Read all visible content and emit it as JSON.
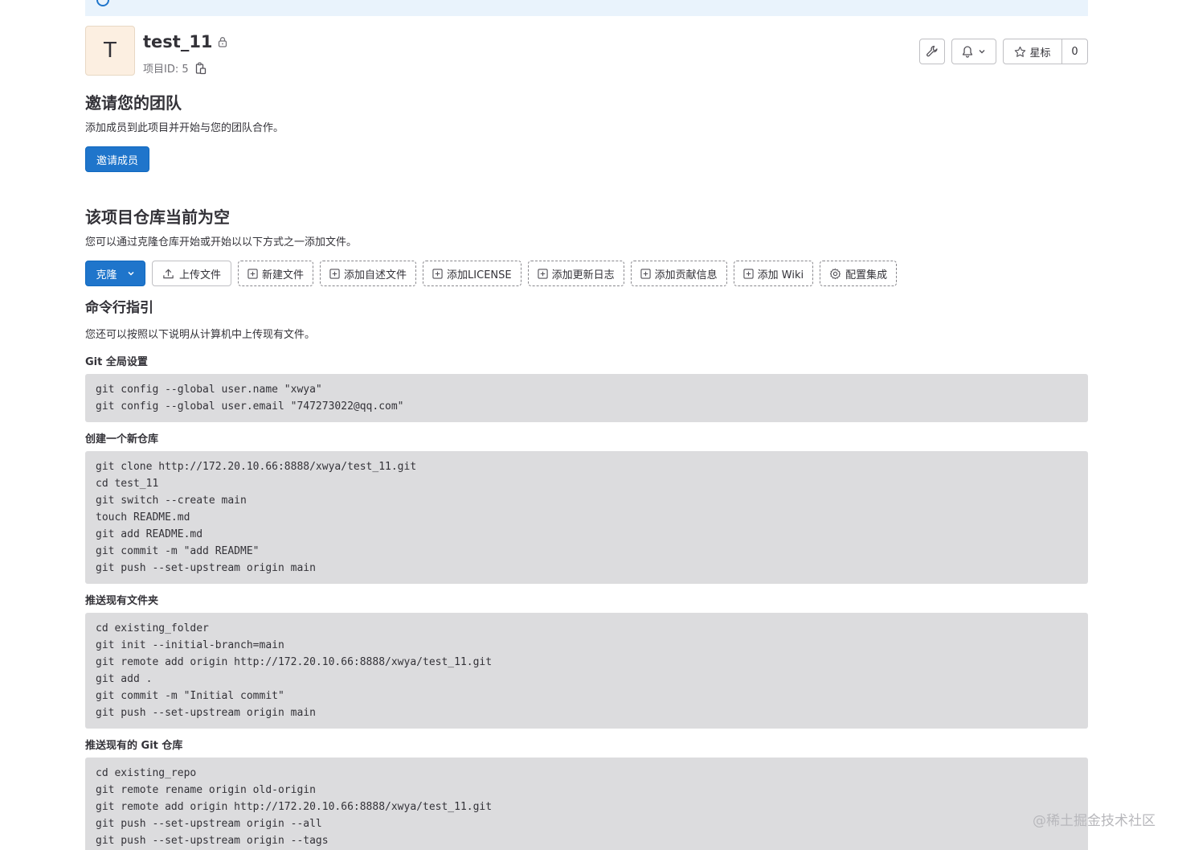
{
  "project": {
    "avatar_letter": "T",
    "name": "test_11",
    "id_label": "项目ID: 5"
  },
  "header_actions": {
    "star_label": "星标",
    "star_count": "0"
  },
  "invite": {
    "title": "邀请您的团队",
    "description": "添加成员到此项目并开始与您的团队合作。",
    "button_label": "邀请成员"
  },
  "empty_repo": {
    "title": "该项目仓库当前为空",
    "description": "您可以通过克隆仓库开始或开始以以下方式之一添加文件。",
    "buttons": {
      "clone": "克隆",
      "upload": "上传文件",
      "new_file": "新建文件",
      "readme": "添加自述文件",
      "license": "添加LICENSE",
      "changelog": "添加更新日志",
      "contributing": "添加贡献信息",
      "wiki": "添加 Wiki",
      "integrations": "配置集成"
    }
  },
  "cli": {
    "title": "命令行指引",
    "description": "您还可以按照以下说明从计算机中上传现有文件。",
    "sections": [
      {
        "title": "Git 全局设置",
        "lines": [
          "git config --global user.name \"xwya\"",
          "git config --global user.email \"747273022@qq.com\""
        ]
      },
      {
        "title": "创建一个新仓库",
        "lines": [
          "git clone http://172.20.10.66:8888/xwya/test_11.git",
          "cd test_11",
          "git switch --create main",
          "touch README.md",
          "git add README.md",
          "git commit -m \"add README\"",
          "git push --set-upstream origin main"
        ]
      },
      {
        "title": "推送现有文件夹",
        "lines": [
          "cd existing_folder",
          "git init --initial-branch=main",
          "git remote add origin http://172.20.10.66:8888/xwya/test_11.git",
          "git add .",
          "git commit -m \"Initial commit\"",
          "git push --set-upstream origin main"
        ]
      },
      {
        "title": "推送现有的 Git 仓库",
        "lines": [
          "cd existing_repo",
          "git remote rename origin old-origin",
          "git remote add origin http://172.20.10.66:8888/xwya/test_11.git",
          "git push --set-upstream origin --all",
          "git push --set-upstream origin --tags"
        ]
      }
    ]
  },
  "watermark": "@稀土掘金技术社区",
  "icons": {
    "lock": "lock-icon",
    "copy": "copy-icon",
    "wrench": "wrench-icon",
    "bell": "bell-icon",
    "star": "star-icon",
    "upload": "upload-icon",
    "plus_square": "plus-square-icon",
    "settings": "settings-icon"
  },
  "colors": {
    "primary": "#1f75cb",
    "code_bg": "#dcdcde",
    "banner_bg": "#e9f3fc",
    "avatar_bg": "#fcefe1"
  }
}
